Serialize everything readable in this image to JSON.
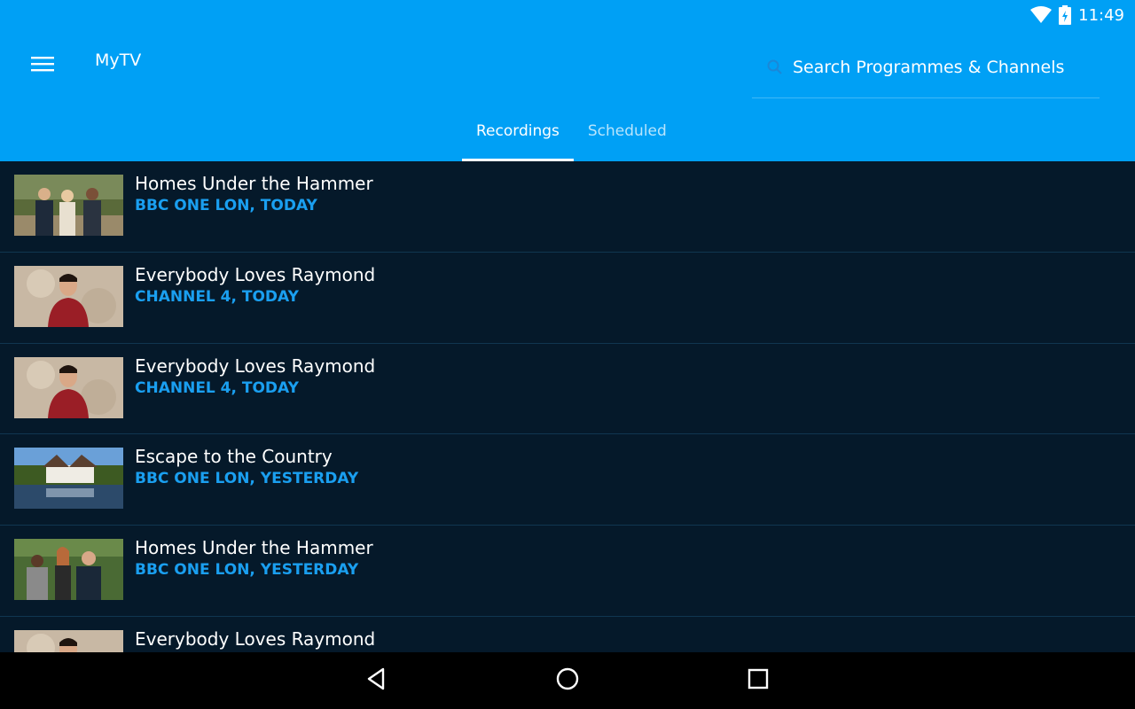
{
  "status_bar": {
    "time": "11:49",
    "icons": [
      "wifi-icon",
      "battery-icon"
    ]
  },
  "header": {
    "title": "MyTV",
    "menu_icon": "hamburger-menu-icon"
  },
  "search": {
    "placeholder": "Search Programmes & Channels",
    "icon": "search-icon"
  },
  "tabs": [
    {
      "label": "Recordings",
      "active": true
    },
    {
      "label": "Scheduled",
      "active": false
    }
  ],
  "recordings": [
    {
      "title": "Homes Under the Hammer",
      "meta": "BBC ONE LON, TODAY"
    },
    {
      "title": "Everybody Loves Raymond",
      "meta": "CHANNEL 4, TODAY"
    },
    {
      "title": "Everybody Loves Raymond",
      "meta": "CHANNEL 4, TODAY"
    },
    {
      "title": "Escape to the Country",
      "meta": "BBC ONE LON, YESTERDAY"
    },
    {
      "title": "Homes Under the Hammer",
      "meta": "BBC ONE LON, YESTERDAY"
    },
    {
      "title": "Everybody Loves Raymond",
      "meta": ""
    }
  ],
  "nav_bar": {
    "icons": [
      "back-icon",
      "home-icon",
      "recents-icon"
    ]
  },
  "colors": {
    "accent": "#00a0f5",
    "background": "#05192a",
    "meta_text": "#1a9ff0"
  }
}
